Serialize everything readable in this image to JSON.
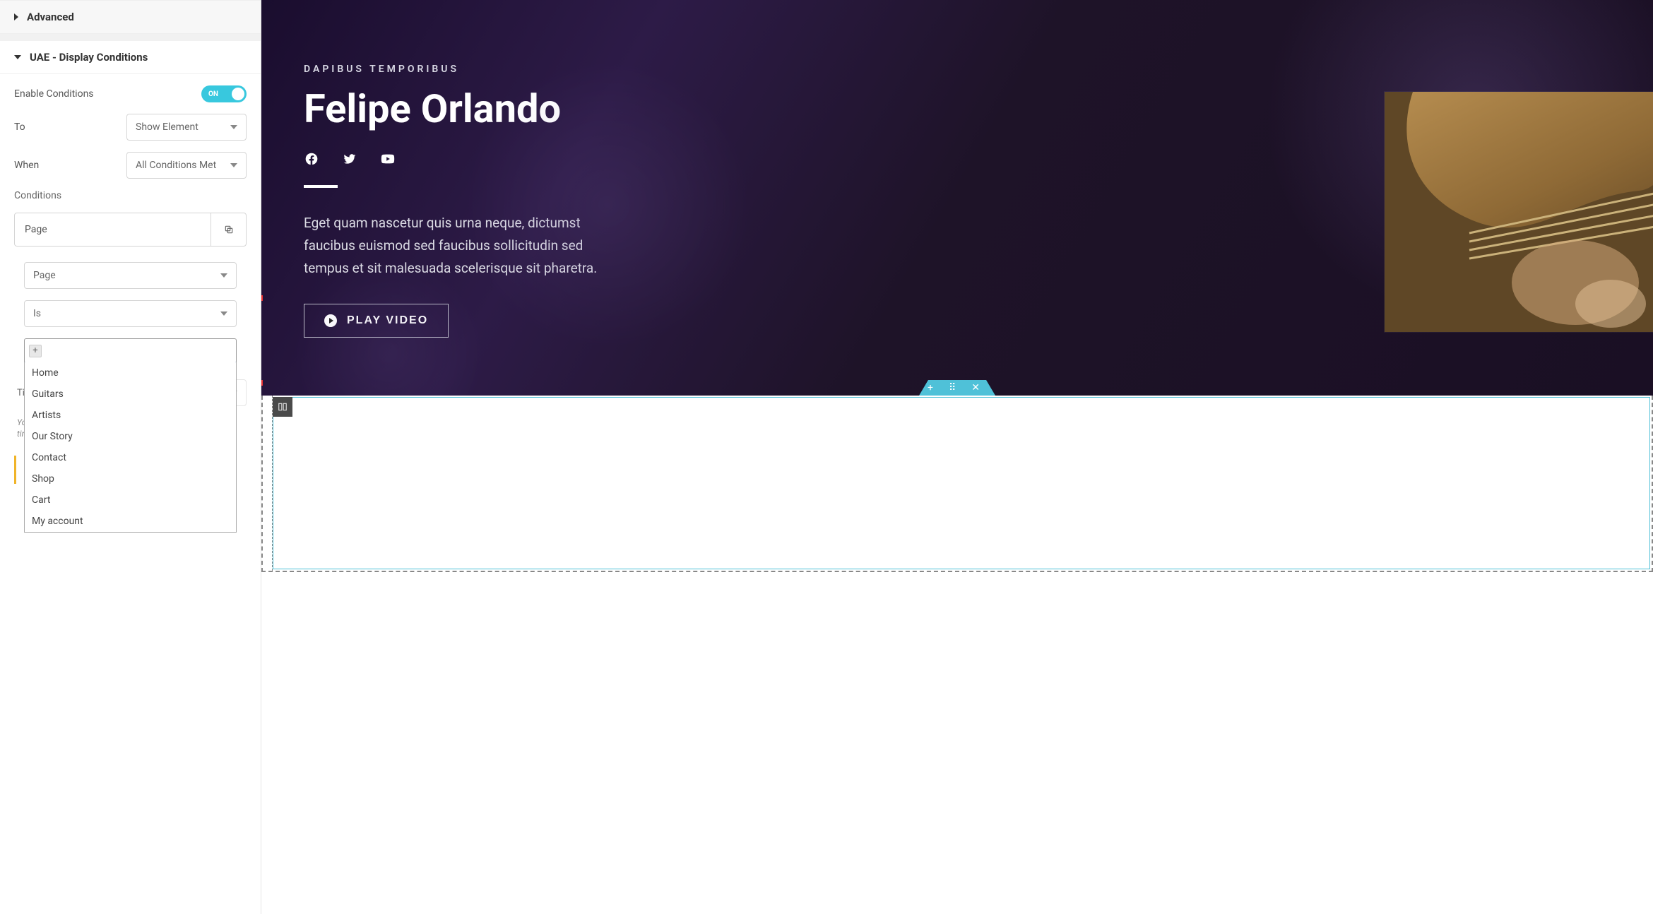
{
  "sidebar": {
    "section_advanced": "Advanced",
    "section_conditions": "UAE - Display Conditions",
    "enable_label": "Enable Conditions",
    "toggle_on_text": "ON",
    "to_label": "To",
    "to_value": "Show Element",
    "when_label": "When",
    "when_value": "All Conditions Met",
    "conditions_label": "Conditions",
    "cond_title": "Page",
    "cond_type_value": "Page",
    "cond_op_value": "Is",
    "tag_add_glyph": "+",
    "dropdown_items": [
      "Home",
      "Guitars",
      "Artists",
      "Our Story",
      "Contact",
      "Shop",
      "Cart",
      "My account"
    ],
    "hidden_label_prefix": "Ti",
    "hidden_hint_prefix": "Yo",
    "hidden_hint_line2": "tir"
  },
  "hero": {
    "eyebrow": "DAPIBUS TEMPORIBUS",
    "title": "Felipe Orlando",
    "paragraph": "Eget quam nascetur quis urna neque, dictumst faucibus euismod sed faucibus sollicitudin sed tempus et sit malesuada scelerisque sit pharetra.",
    "play_label": "PLAY VIDEO"
  },
  "section_toolbar": {
    "add": "+",
    "drag": "⠿",
    "close": "✕"
  }
}
